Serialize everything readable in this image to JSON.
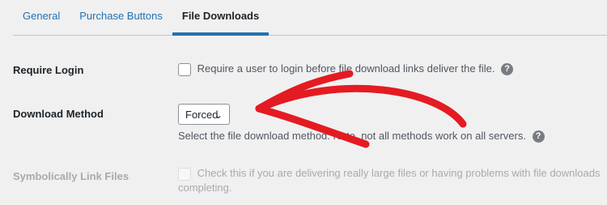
{
  "tabs": [
    {
      "label": "General"
    },
    {
      "label": "Purchase Buttons"
    },
    {
      "label": "File Downloads"
    }
  ],
  "settings": {
    "require_login": {
      "label": "Require Login",
      "checkbox_text": "Require a user to login before file download links deliver the file.",
      "help": "?"
    },
    "download_method": {
      "label": "Download Method",
      "selected": "Forced",
      "description": "Select the file download method. Note, not all methods work on all servers.",
      "help": "?"
    },
    "symlink": {
      "label": "Symbolically Link Files",
      "text_line1": "Check this if you are delivering really large files or having problems with file downloads",
      "text_line2": "completing."
    }
  },
  "colors": {
    "accent": "#2271b1",
    "annotation_arrow": "#e41b22"
  }
}
